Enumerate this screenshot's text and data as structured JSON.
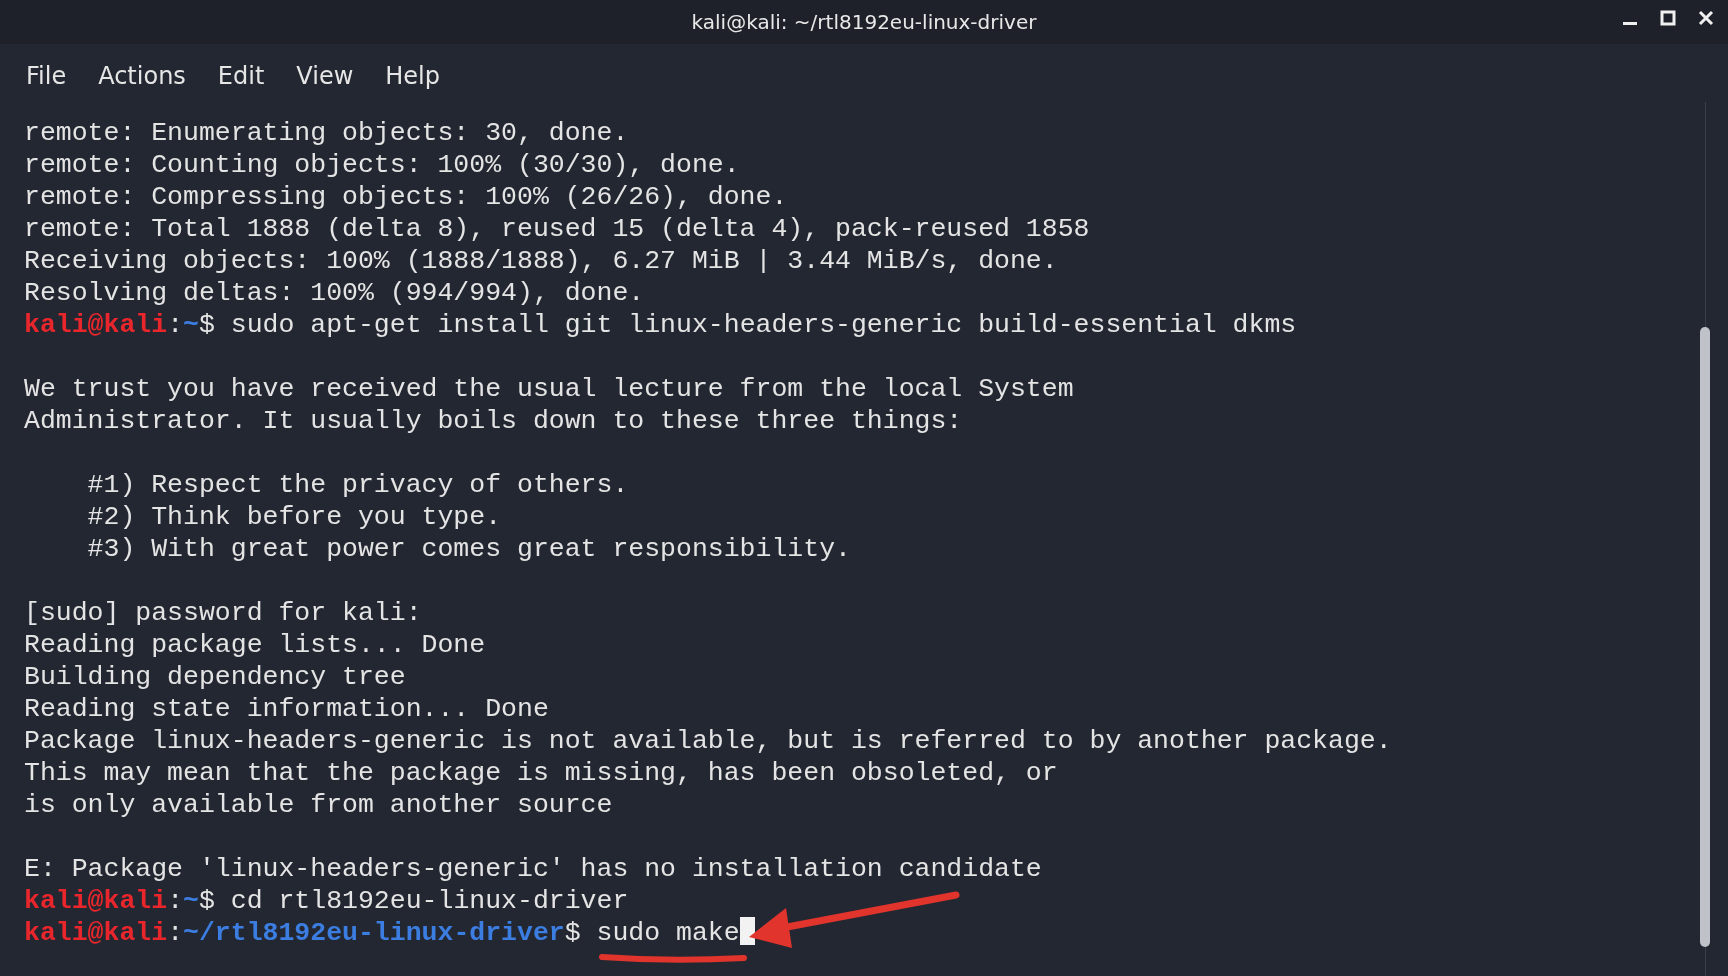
{
  "window": {
    "title": "kali@kali: ~/rtl8192eu-linux-driver"
  },
  "menu": [
    "File",
    "Actions",
    "Edit",
    "View",
    "Help"
  ],
  "terminal": {
    "lines": [
      {
        "kind": "output",
        "text": "remote: Enumerating objects: 30, done."
      },
      {
        "kind": "output",
        "text": "remote: Counting objects: 100% (30/30), done."
      },
      {
        "kind": "output",
        "text": "remote: Compressing objects: 100% (26/26), done."
      },
      {
        "kind": "output",
        "text": "remote: Total 1888 (delta 8), reused 15 (delta 4), pack-reused 1858"
      },
      {
        "kind": "output",
        "text": "Receiving objects: 100% (1888/1888), 6.27 MiB | 3.44 MiB/s, done."
      },
      {
        "kind": "output",
        "text": "Resolving deltas: 100% (994/994), done."
      },
      {
        "kind": "prompt",
        "user": "kali@kali",
        "separator": ":",
        "path": "~",
        "command": "$ sudo apt-get install git linux-headers-generic build-essential dkms"
      },
      {
        "kind": "blank"
      },
      {
        "kind": "output",
        "text": "We trust you have received the usual lecture from the local System"
      },
      {
        "kind": "output",
        "text": "Administrator. It usually boils down to these three things:"
      },
      {
        "kind": "blank"
      },
      {
        "kind": "output",
        "text": "    #1) Respect the privacy of others."
      },
      {
        "kind": "output",
        "text": "    #2) Think before you type."
      },
      {
        "kind": "output",
        "text": "    #3) With great power comes great responsibility."
      },
      {
        "kind": "blank"
      },
      {
        "kind": "output",
        "text": "[sudo] password for kali:"
      },
      {
        "kind": "output",
        "text": "Reading package lists... Done"
      },
      {
        "kind": "output",
        "text": "Building dependency tree"
      },
      {
        "kind": "output",
        "text": "Reading state information... Done"
      },
      {
        "kind": "output",
        "text": "Package linux-headers-generic is not available, but is referred to by another package."
      },
      {
        "kind": "output",
        "text": "This may mean that the package is missing, has been obsoleted, or"
      },
      {
        "kind": "output",
        "text": "is only available from another source"
      },
      {
        "kind": "blank"
      },
      {
        "kind": "output",
        "text": "E: Package 'linux-headers-generic' has no installation candidate"
      },
      {
        "kind": "prompt",
        "user": "kali@kali",
        "separator": ":",
        "path": "~",
        "command": "$ cd rtl8192eu-linux-driver"
      },
      {
        "kind": "prompt",
        "user": "kali@kali",
        "separator": ":",
        "path": "~/rtl8192eu-linux-driver",
        "command": "$ sudo make",
        "cursor": true
      }
    ]
  }
}
